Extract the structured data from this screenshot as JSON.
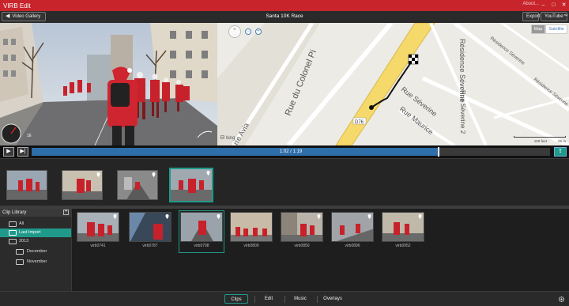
{
  "window": {
    "title": "VIRB Edit",
    "about_label": "About..."
  },
  "toolbar": {
    "gallery_label": "Video Gallery",
    "project_title": "Santa 10K Race",
    "export_label": "Export",
    "youtube_label": "YouTube™"
  },
  "map": {
    "toggle": {
      "map_label": "Map",
      "satellite_label": "Satellite",
      "selected": "Map"
    },
    "streets": [
      "Rue du Colonel Pi",
      "Résidence Séverine",
      "Rue Séverine",
      "Rue Séverine 2",
      "Rue Maurice",
      "Résidence Séverine",
      "Résidence Séverine",
      "rre Avia"
    ],
    "route_label": "D76",
    "provider": "bing",
    "scale": {
      "feet": "100 feet",
      "meters": "25 m"
    }
  },
  "gauge": {
    "speed_value": "16"
  },
  "playback": {
    "time": "1:02 / 1:19",
    "progress": 0.785
  },
  "edit_strip": {
    "clips": [
      {
        "has_pin": false
      },
      {
        "has_pin": true
      },
      {
        "has_pin": true
      },
      {
        "has_pin": true
      }
    ],
    "selected_index": 3
  },
  "library": {
    "title": "Clip Library",
    "folders": [
      {
        "label": "All",
        "selected": false,
        "indent": false
      },
      {
        "label": "Last Import",
        "selected": true,
        "indent": false
      },
      {
        "label": "2013",
        "selected": false,
        "indent": false
      },
      {
        "label": "December",
        "selected": false,
        "indent": true
      },
      {
        "label": "November",
        "selected": false,
        "indent": true
      }
    ],
    "clips": [
      {
        "name": "virb0741",
        "selected": false
      },
      {
        "name": "virb0787",
        "selected": false
      },
      {
        "name": "virb0798",
        "selected": true
      },
      {
        "name": "virb0809",
        "selected": false
      },
      {
        "name": "virb0850",
        "selected": false
      },
      {
        "name": "virb0896",
        "selected": false
      },
      {
        "name": "virb0952",
        "selected": false
      }
    ]
  },
  "tabs": [
    {
      "label": "Clips",
      "active": true
    },
    {
      "label": "Edit",
      "active": false
    },
    {
      "label": "Music",
      "active": false
    },
    {
      "label": "Overlays",
      "active": false
    }
  ],
  "colors": {
    "brand_red": "#c8242b",
    "accent_teal": "#1f9a8a",
    "timeline_blue": "#2e6ea9",
    "route_yellow": "#f5d96b"
  },
  "icons": [
    "back-arrow-icon",
    "minimize-icon",
    "maximize-icon",
    "close-icon",
    "play-icon",
    "step-forward-icon",
    "share-icon",
    "add-folder-icon",
    "folder-icon",
    "pin-icon",
    "gear-icon",
    "finish-flag-icon"
  ]
}
